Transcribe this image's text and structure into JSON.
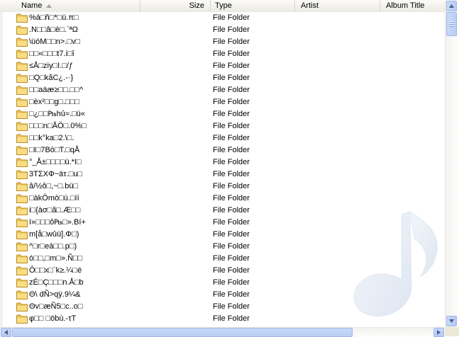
{
  "columns": {
    "name": "Name",
    "size": "Size",
    "type": "Type",
    "artist": "Artist",
    "album_title": "Album Title"
  },
  "rows": [
    {
      "name": "%á□ñ□*□ü.π□",
      "type": "File Folder"
    },
    {
      "name": ".N□□â□è□.`ªΩ",
      "type": "File Folder"
    },
    {
      "name": "\\üóM□□n>.□v□",
      "type": "File Folder"
    },
    {
      "name": "□□«□□□t7.i□î",
      "type": "File Folder"
    },
    {
      "name": "≤Å□ziy□I.□/ƒ",
      "type": "File Folder"
    },
    {
      "name": "□Q□kãC¿.-·}",
      "type": "File Folder"
    },
    {
      "name": "□□aäæ≥□□.□□^",
      "type": "File Folder"
    },
    {
      "name": "□èx²□□g□.□□□",
      "type": "File Folder"
    },
    {
      "name": "□¿□□₧hû≈.□ü«",
      "type": "File Folder"
    },
    {
      "name": "□□□n□ÅÖ□.0%□",
      "type": "File Folder"
    },
    {
      "name": "□□k°ka□2.\\□.",
      "type": "File Folder"
    },
    {
      "name": "□I□7Bò□T.□qÅ",
      "type": "File Folder"
    },
    {
      "name": "°_Å±□□□□ü.*I□",
      "type": "File Folder"
    },
    {
      "name": "3TΣXΦ~äτ.□u□",
      "type": "File Folder"
    },
    {
      "name": "â/½ô□,~□.bü□",
      "type": "File Folder"
    },
    {
      "name": "□àkÖmò□ú.□íí",
      "type": "File Folder"
    },
    {
      "name": "i□{àσ□ã□.Æ□□",
      "type": "File Folder"
    },
    {
      "name": "ï»□□□ô₧□».Bí+",
      "type": "File Folder"
    },
    {
      "name": "m[å□wûü].Φ□)",
      "type": "File Folder"
    },
    {
      "name": "^□r□eà□□.p□)",
      "type": "File Folder"
    },
    {
      "name": "ó□□,□m□».Ñ□□",
      "type": "File Folder"
    },
    {
      "name": "Ô□□x□`k≥.¼□é",
      "type": "File Folder"
    },
    {
      "name": "zÉ□Ç□□□n.Å□b",
      "type": "File Folder"
    },
    {
      "name": "Θ\\ dÑ>qÿ.9¼&",
      "type": "File Folder"
    },
    {
      "name": "Θv□æÑ5□c..o□",
      "type": "File Folder"
    },
    {
      "name": "φ□□ □öbú.-τT",
      "type": "File Folder"
    }
  ]
}
